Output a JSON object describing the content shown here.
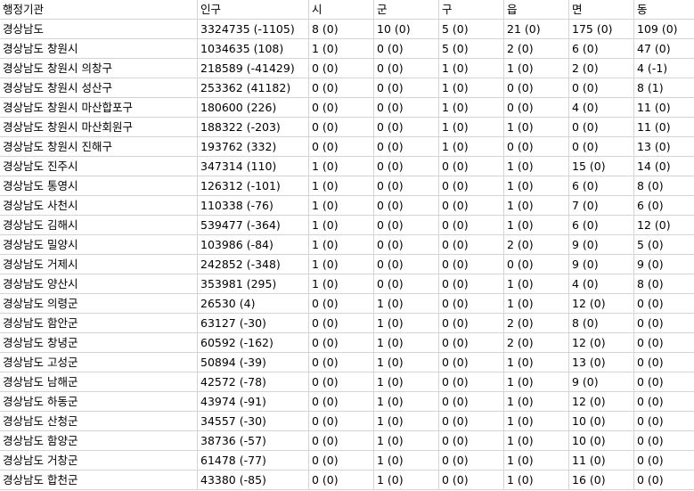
{
  "headers": [
    "행정기관",
    "인구",
    "시",
    "군",
    "구",
    "읍",
    "면",
    "동"
  ],
  "rows": [
    [
      "경상남도",
      "3324735 (-1105)",
      "8 (0)",
      "10 (0)",
      "5 (0)",
      "21 (0)",
      "175 (0)",
      "109 (0)"
    ],
    [
      "경상남도 창원시",
      "1034635 (108)",
      "1 (0)",
      "0 (0)",
      "5 (0)",
      "2 (0)",
      "6 (0)",
      "47 (0)"
    ],
    [
      "경상남도 창원시 의창구",
      "218589 (-41429)",
      "0 (0)",
      "0 (0)",
      "1 (0)",
      "1 (0)",
      "2 (0)",
      "4 (-1)"
    ],
    [
      "경상남도 창원시 성산구",
      "253362 (41182)",
      "0 (0)",
      "0 (0)",
      "1 (0)",
      "0 (0)",
      "0 (0)",
      "8 (1)"
    ],
    [
      "경상남도 창원시 마산합포구",
      "180600 (226)",
      "0 (0)",
      "0 (0)",
      "1 (0)",
      "0 (0)",
      "4 (0)",
      "11 (0)"
    ],
    [
      "경상남도 창원시 마산회원구",
      "188322 (-203)",
      "0 (0)",
      "0 (0)",
      "1 (0)",
      "1 (0)",
      "0 (0)",
      "11 (0)"
    ],
    [
      "경상남도 창원시 진해구",
      "193762 (332)",
      "0 (0)",
      "0 (0)",
      "1 (0)",
      "0 (0)",
      "0 (0)",
      "13 (0)"
    ],
    [
      "경상남도 진주시",
      "347314 (110)",
      "1 (0)",
      "0 (0)",
      "0 (0)",
      "1 (0)",
      "15 (0)",
      "14 (0)"
    ],
    [
      "경상남도 통영시",
      "126312 (-101)",
      "1 (0)",
      "0 (0)",
      "0 (0)",
      "1 (0)",
      "6 (0)",
      "8 (0)"
    ],
    [
      "경상남도 사천시",
      "110338 (-76)",
      "1 (0)",
      "0 (0)",
      "0 (0)",
      "1 (0)",
      "7 (0)",
      "6 (0)"
    ],
    [
      "경상남도 김해시",
      "539477 (-364)",
      "1 (0)",
      "0 (0)",
      "0 (0)",
      "1 (0)",
      "6 (0)",
      "12 (0)"
    ],
    [
      "경상남도 밀양시",
      "103986 (-84)",
      "1 (0)",
      "0 (0)",
      "0 (0)",
      "2 (0)",
      "9 (0)",
      "5 (0)"
    ],
    [
      "경상남도 거제시",
      "242852 (-348)",
      "1 (0)",
      "0 (0)",
      "0 (0)",
      "0 (0)",
      "9 (0)",
      "9 (0)"
    ],
    [
      "경상남도 양산시",
      "353981 (295)",
      "1 (0)",
      "0 (0)",
      "0 (0)",
      "1 (0)",
      "4 (0)",
      "8 (0)"
    ],
    [
      "경상남도 의령군",
      "26530 (4)",
      "0 (0)",
      "1 (0)",
      "0 (0)",
      "1 (0)",
      "12 (0)",
      "0 (0)"
    ],
    [
      "경상남도 함안군",
      "63127 (-30)",
      "0 (0)",
      "1 (0)",
      "0 (0)",
      "2 (0)",
      "8 (0)",
      "0 (0)"
    ],
    [
      "경상남도 창녕군",
      "60592 (-162)",
      "0 (0)",
      "1 (0)",
      "0 (0)",
      "2 (0)",
      "12 (0)",
      "0 (0)"
    ],
    [
      "경상남도 고성군",
      "50894 (-39)",
      "0 (0)",
      "1 (0)",
      "0 (0)",
      "1 (0)",
      "13 (0)",
      "0 (0)"
    ],
    [
      "경상남도 남해군",
      "42572 (-78)",
      "0 (0)",
      "1 (0)",
      "0 (0)",
      "1 (0)",
      "9 (0)",
      "0 (0)"
    ],
    [
      "경상남도 하동군",
      "43974 (-91)",
      "0 (0)",
      "1 (0)",
      "0 (0)",
      "1 (0)",
      "12 (0)",
      "0 (0)"
    ],
    [
      "경상남도 산청군",
      "34557 (-30)",
      "0 (0)",
      "1 (0)",
      "0 (0)",
      "1 (0)",
      "10 (0)",
      "0 (0)"
    ],
    [
      "경상남도 함양군",
      "38736 (-57)",
      "0 (0)",
      "1 (0)",
      "0 (0)",
      "1 (0)",
      "10 (0)",
      "0 (0)"
    ],
    [
      "경상남도 거창군",
      "61478 (-77)",
      "0 (0)",
      "1 (0)",
      "0 (0)",
      "1 (0)",
      "11 (0)",
      "0 (0)"
    ],
    [
      "경상남도 합천군",
      "43380 (-85)",
      "0 (0)",
      "1 (0)",
      "0 (0)",
      "1 (0)",
      "16 (0)",
      "0 (0)"
    ]
  ]
}
